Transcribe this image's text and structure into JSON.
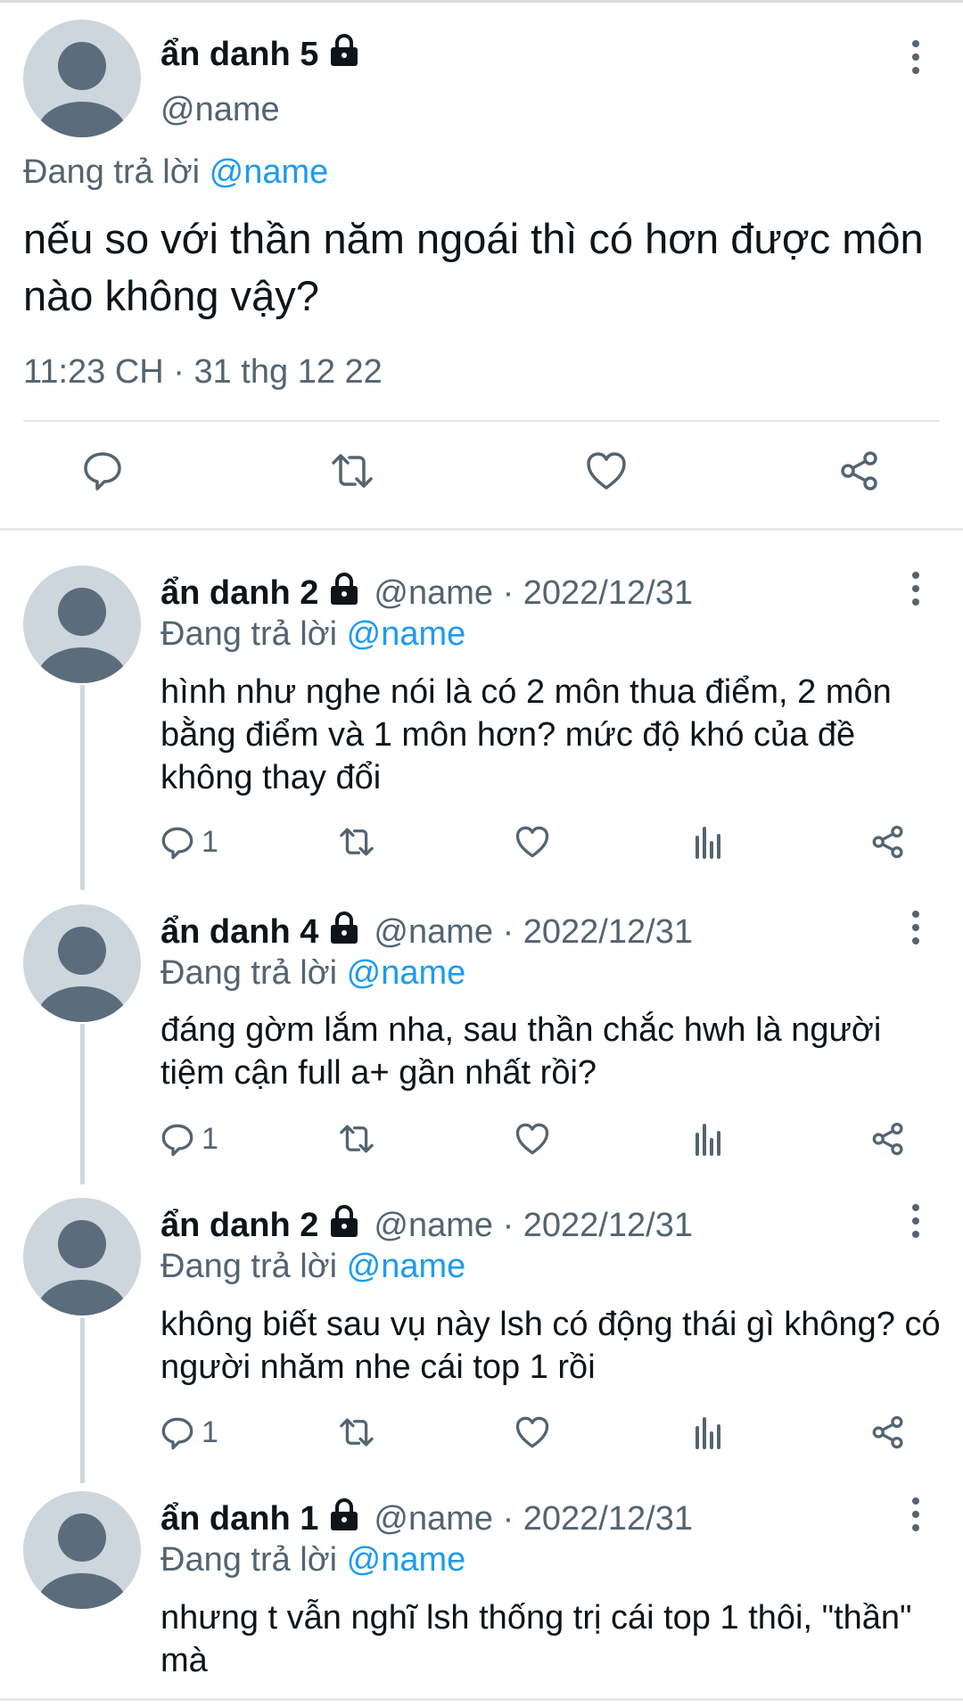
{
  "main_tweet": {
    "author_name": "ẩn danh 5",
    "handle": "@name",
    "replying_prefix": "Đang trả lời",
    "replying_to": "@name",
    "text": "nếu so với thần năm ngoái thì có hơn được môn nào không vậy?",
    "timestamp": "11:23 CH · 31 thg 12 22"
  },
  "replies": [
    {
      "author_name": "ẩn danh 2",
      "handle_date": "@name · 2022/12/31",
      "replying_prefix": "Đang trả lời",
      "replying_to": "@name",
      "text": "hình như nghe nói là có 2 môn thua điểm, 2 môn bằng điểm và 1 môn hơn? mức độ khó của đề không thay đổi",
      "reply_count": "1"
    },
    {
      "author_name": "ẩn danh 4",
      "handle_date": "@name · 2022/12/31",
      "replying_prefix": "Đang trả lời",
      "replying_to": "@name",
      "text": "đáng gờm lắm nha, sau thần chắc hwh là người tiệm cận full a+ gần nhất rồi?",
      "reply_count": "1"
    },
    {
      "author_name": "ẩn danh 2",
      "handle_date": "@name · 2022/12/31",
      "replying_prefix": "Đang trả lời",
      "replying_to": "@name",
      "text": "không biết sau vụ này lsh có động thái gì không? có người nhăm nhe cái top 1 rồi",
      "reply_count": "1"
    },
    {
      "author_name": "ẩn danh 1",
      "handle_date": "@name · 2022/12/31",
      "replying_prefix": "Đang trả lời",
      "replying_to": "@name",
      "text": "nhưng t vẫn nghĩ lsh thống trị cái top 1 thôi, \"thần\" mà"
    }
  ],
  "icons": {
    "reply": "reply-icon",
    "retweet": "retweet-icon",
    "like": "like-icon",
    "analytics": "analytics-icon",
    "share": "share-icon",
    "more": "more-icon",
    "lock": "lock-icon"
  },
  "colors": {
    "mention": "#1d9bf0",
    "secondary_text": "#536471",
    "avatar_bg": "#cdd6dd",
    "avatar_fg": "#5b6c7c"
  }
}
